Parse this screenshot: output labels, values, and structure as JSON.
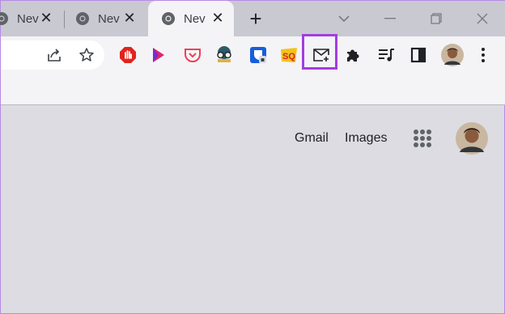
{
  "tabs": [
    {
      "title": "Nev",
      "close": "✕",
      "favicon": "chrome-icon"
    },
    {
      "title": "Nev",
      "close": "✕",
      "favicon": "chrome-icon"
    },
    {
      "title": "Nev",
      "close": "✕",
      "favicon": "chrome-icon",
      "active": true
    }
  ],
  "tabstrip": {
    "new_tab": "+"
  },
  "extensions": [
    "adblock-icon",
    "bookmark-arrow-icon",
    "pocket-icon",
    "spy-glasses-icon",
    "bitwarden-shield-icon",
    "sq-badge-icon",
    "email-plus-icon",
    "puzzle-extensions-icon",
    "media-playlist-icon",
    "side-panel-icon"
  ],
  "highlighted_extension": "email-plus-icon",
  "colors": {
    "highlight": "#a33de0",
    "tabstrip": "#c9c9d2",
    "content": "#dcdce2"
  },
  "google_header": {
    "gmail": "Gmail",
    "images": "Images"
  }
}
